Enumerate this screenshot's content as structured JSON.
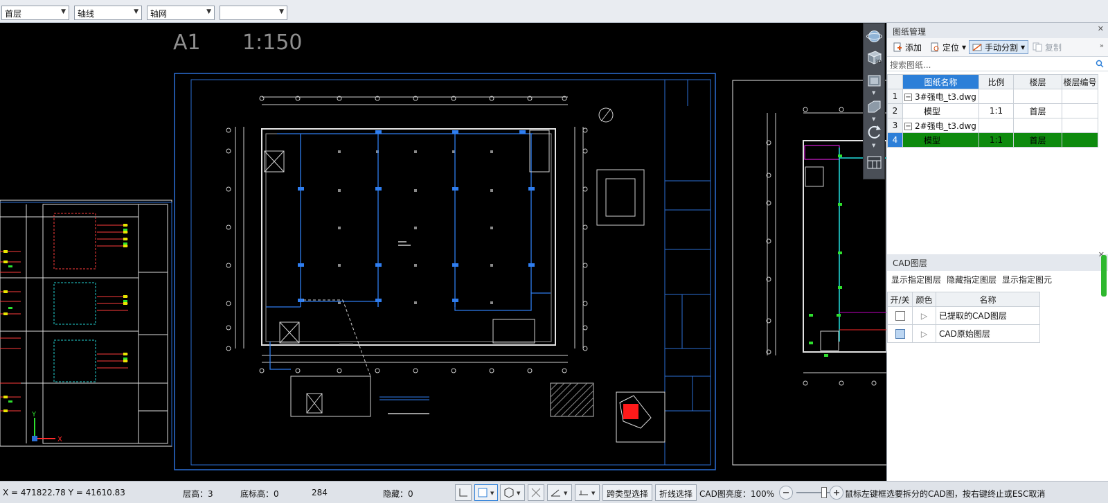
{
  "toolbar": {
    "floor_select": "首层",
    "axis_line_select": "轴线",
    "axis_grid_select": "轴网",
    "blank_select": ""
  },
  "canvas": {
    "sheet_label": "A1",
    "scale_label": "1:150",
    "axis_x": "X",
    "axis_y": "Y"
  },
  "drawing_manager": {
    "title": "图纸管理",
    "add": "添加",
    "locate": "定位",
    "manual_split": "手动分割",
    "copy": "复制",
    "search_placeholder": "搜索图纸...",
    "columns": [
      "图纸名称",
      "比例",
      "楼层",
      "楼层编号"
    ],
    "rows": [
      {
        "num": "1",
        "name": "3#强电_t3.dwg",
        "scale": "",
        "floor": "",
        "floor_no": "",
        "toggle": "−"
      },
      {
        "num": "2",
        "name": "模型",
        "scale": "1:1",
        "floor": "首层",
        "floor_no": ""
      },
      {
        "num": "3",
        "name": "2#强电_t3.dwg",
        "scale": "",
        "floor": "",
        "floor_no": "",
        "toggle": "−"
      },
      {
        "num": "4",
        "name": "模型",
        "scale": "1:1",
        "floor": "首层",
        "floor_no": ""
      }
    ]
  },
  "cad_layers": {
    "title": "CAD图层",
    "show_specified_layer": "显示指定图层",
    "hide_specified_layer": "隐藏指定图层",
    "show_specified_element": "显示指定图元",
    "columns": [
      "开/关",
      "颜色",
      "名称"
    ],
    "rows": [
      {
        "name": "已提取的CAD图层"
      },
      {
        "name": "CAD原始图层"
      }
    ]
  },
  "status": {
    "coords": "X = 471822.78 Y = 41610.83",
    "floor_height": "层高：3",
    "base_height": "底标高：0",
    "count": "284",
    "hidden": "隐藏：0",
    "cross_type_select": "跨类型选择",
    "polyline_select": "折线选择",
    "cad_brightness": "CAD图亮度：100%",
    "hint": "鼠标左键框选要拆分的CAD图，按右键终止或ESC取消"
  }
}
